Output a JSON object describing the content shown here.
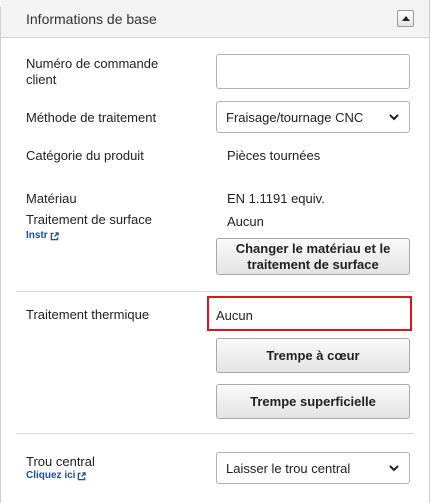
{
  "header": {
    "title": "Informations de base"
  },
  "fields": {
    "order_number_label": "Numéro de commande client",
    "order_number_value": "",
    "processing_method_label": "Méthode de traitement",
    "processing_method_value": "Fraisage/tournage CNC",
    "product_category_label": "Catégorie du produit",
    "product_category_value": "Pièces tournées",
    "material_label": "Matériau",
    "material_value": "EN 1.1191 equiv.",
    "surface_treatment_label": "Traitement de surface",
    "surface_treatment_value": "Aucun",
    "surface_instr_link": "Instr"
  },
  "buttons": {
    "change_material": "Changer le matériau et le traitement de surface",
    "hardening": "Trempe à cœur",
    "surface_hardening": "Trempe superficielle"
  },
  "heat_treatment": {
    "label": "Traitement thermique",
    "value": "Aucun"
  },
  "center_hole": {
    "label": "Trou central",
    "link": "Cliquez ici",
    "value": "Laisser le trou central"
  },
  "colors": {
    "highlight": "#e0141e",
    "link": "#1c4fa0"
  },
  "icons": [
    "chevron-up-icon",
    "chevron-down-icon",
    "external-link-icon"
  ]
}
